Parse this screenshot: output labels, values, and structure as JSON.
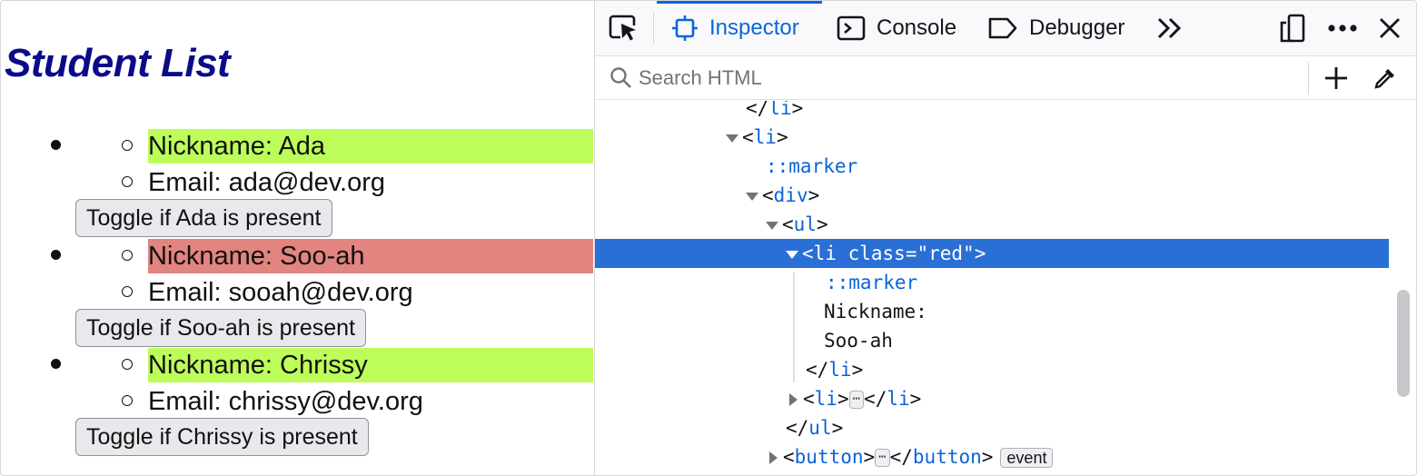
{
  "page": {
    "title": "Student List",
    "students": [
      {
        "nickname": "Nickname: Ada",
        "email": "Email: ada@dev.org",
        "button": "Toggle if Ada is present",
        "highlight": "#bdfd5a"
      },
      {
        "nickname": "Nickname: Soo-ah",
        "email": "Email: sooah@dev.org",
        "button": "Toggle if Soo-ah is present",
        "highlight": "#e2847f"
      },
      {
        "nickname": "Nickname: Chrissy",
        "email": "Email: chrissy@dev.org",
        "button": "Toggle if Chrissy is present",
        "highlight": "#bdfd5a"
      }
    ]
  },
  "devtools": {
    "tabs": [
      {
        "label": "Inspector",
        "icon": "inspector-icon",
        "active": true
      },
      {
        "label": "Console",
        "icon": "console-icon",
        "active": false
      },
      {
        "label": "Debugger",
        "icon": "debugger-icon",
        "active": false
      }
    ],
    "search_placeholder": "Search HTML",
    "accent": "#0a66d9",
    "tree": {
      "close_li": "li",
      "open_li": "li",
      "marker1": "::marker",
      "div": "div",
      "ul": "ul",
      "sel_tag": "li",
      "sel_attr": "class=\"red\"",
      "marker2": "::marker",
      "text1": "Nickname:",
      "text2": "Soo-ah",
      "close_li2": "li",
      "li_collapsed": "li",
      "li_collapsed_close": "li",
      "close_ul": "ul",
      "button": "button",
      "button_close": "button",
      "event_badge": "event"
    }
  }
}
